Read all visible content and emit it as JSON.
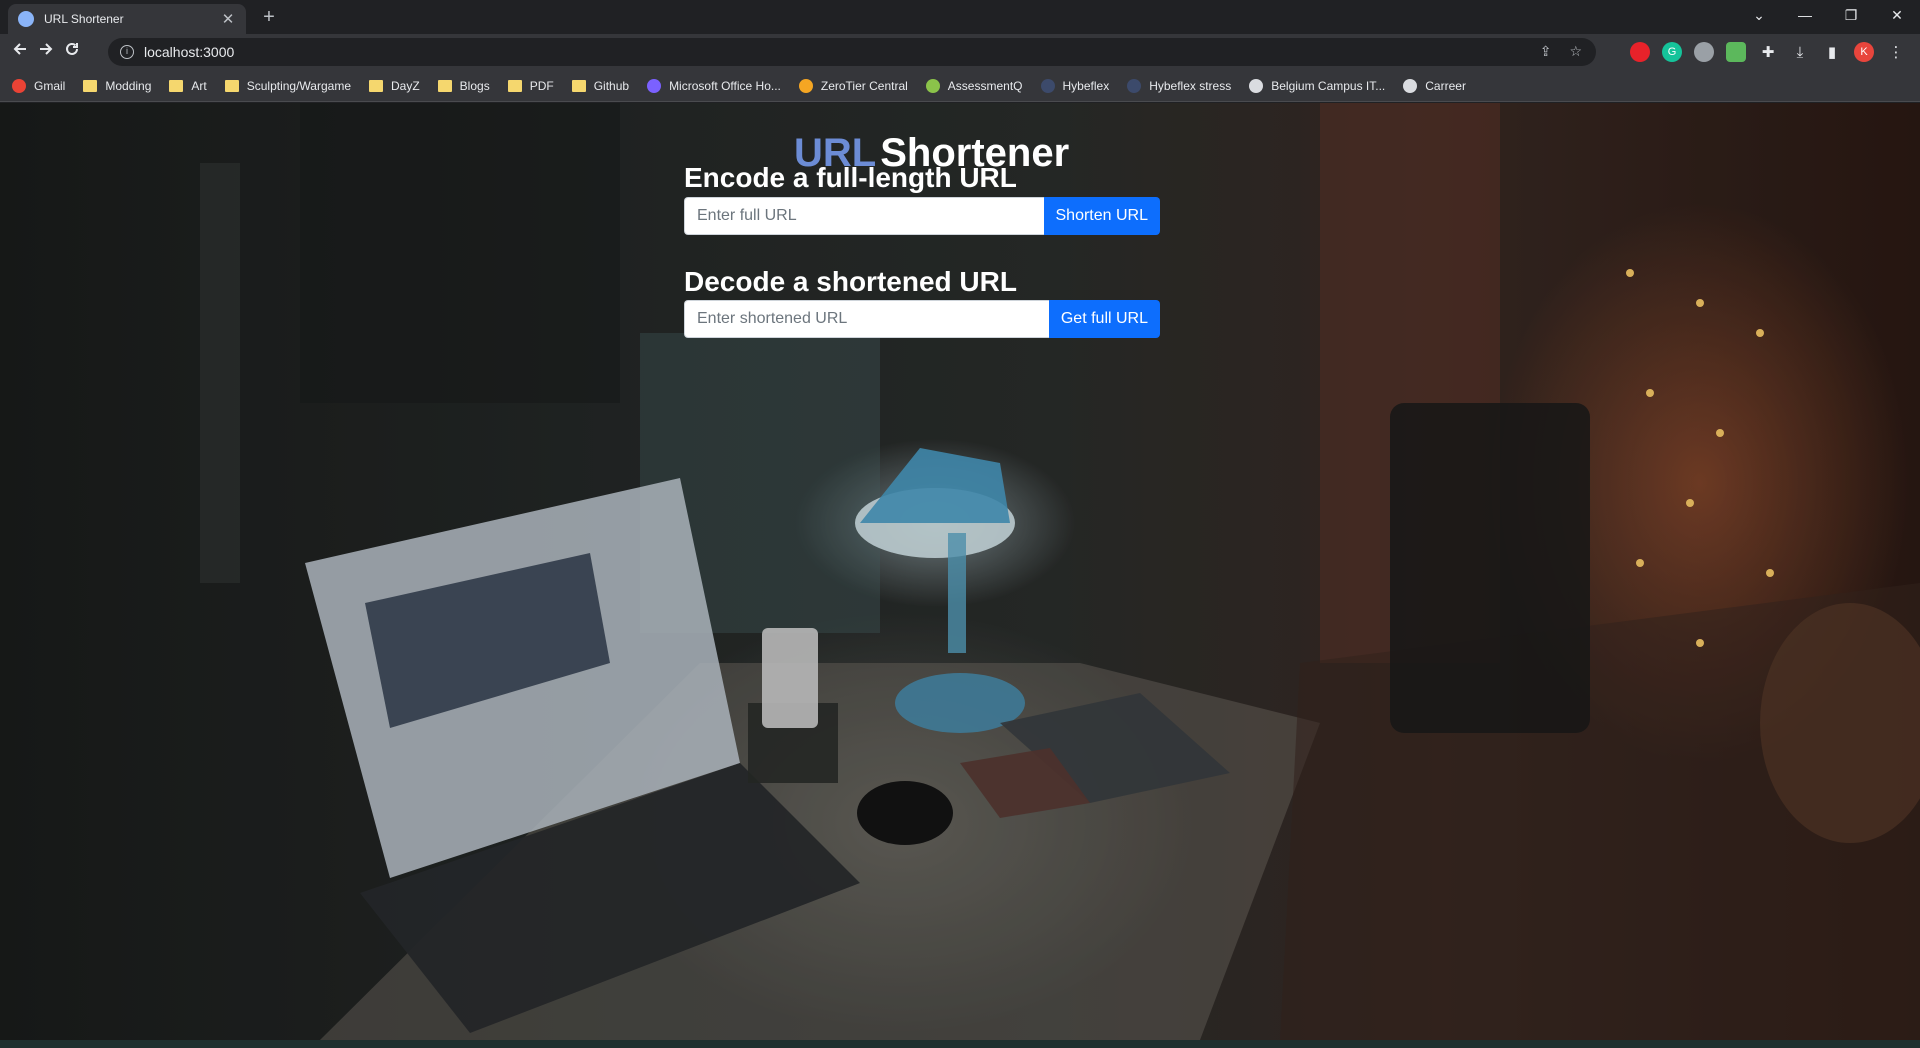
{
  "browser": {
    "tab_title": "URL Shortener",
    "tab_close": "✕",
    "new_tab": "+",
    "url": "localhost:3000",
    "window_controls": {
      "dropdown": "⌄",
      "minimize": "—",
      "restore": "❐",
      "close": "✕"
    },
    "extensions": [
      {
        "name": "adblock-extension-icon",
        "label": "",
        "color": "#e8222a"
      },
      {
        "name": "grammarly-extension-icon",
        "label": "G",
        "color": "#15c39a"
      },
      {
        "name": "owl-extension-icon",
        "label": "",
        "color": "#9aa0a6"
      },
      {
        "name": "android-extension-icon",
        "label": "",
        "color": "#5cb85c"
      }
    ],
    "profile_initial": "K",
    "profile_color": "#e8453c",
    "bookmarks": [
      {
        "label": "Gmail",
        "icon": "gmail-icon",
        "type": "site",
        "color": "#ea4335"
      },
      {
        "label": "Modding",
        "icon": "folder-icon",
        "type": "folder"
      },
      {
        "label": "Art",
        "icon": "folder-icon",
        "type": "folder"
      },
      {
        "label": "Sculpting/Wargame",
        "icon": "folder-icon",
        "type": "folder"
      },
      {
        "label": "DayZ",
        "icon": "folder-icon",
        "type": "folder"
      },
      {
        "label": "Blogs",
        "icon": "folder-icon",
        "type": "folder"
      },
      {
        "label": "PDF",
        "icon": "folder-icon",
        "type": "folder"
      },
      {
        "label": "Github",
        "icon": "folder-icon",
        "type": "folder"
      },
      {
        "label": "Microsoft Office Ho...",
        "icon": "office-icon",
        "type": "site",
        "color": "#7b61ff"
      },
      {
        "label": "ZeroTier Central",
        "icon": "zerotier-icon",
        "type": "site",
        "color": "#f5a623"
      },
      {
        "label": "AssessmentQ",
        "icon": "assessmentq-icon",
        "type": "site",
        "color": "#8bc34a"
      },
      {
        "label": "Hybeflex",
        "icon": "hybeflex-icon",
        "type": "site",
        "color": "#3c4a6b"
      },
      {
        "label": "Hybeflex stress",
        "icon": "hybeflex-icon",
        "type": "site",
        "color": "#3c4a6b"
      },
      {
        "label": "Belgium Campus IT...",
        "icon": "belgium-campus-icon",
        "type": "site",
        "color": "#dadce0"
      },
      {
        "label": "Carreer",
        "icon": "career-icon",
        "type": "site",
        "color": "#dadce0"
      }
    ]
  },
  "app": {
    "brand_part1": "URL",
    "brand_part2": "Shortener",
    "accent_color": "#6c8cd5",
    "button_color": "#0d6efd",
    "encode": {
      "title": "Encode a full-length URL",
      "placeholder": "Enter full URL",
      "value": "",
      "button": "Shorten URL"
    },
    "decode": {
      "title": "Decode a shortened URL",
      "placeholder": "Enter shortened URL",
      "value": "",
      "button": "Get full URL"
    }
  }
}
